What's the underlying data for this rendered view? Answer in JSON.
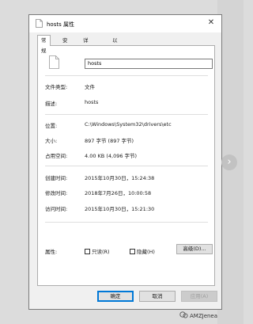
{
  "window": {
    "title": "hosts 属性",
    "close_glyph": "✕"
  },
  "tabs": [
    {
      "label": "常规",
      "active": true
    },
    {
      "label": "安全"
    },
    {
      "label": "详细信息"
    },
    {
      "label": "以前的版本"
    }
  ],
  "general": {
    "filename": "hosts",
    "fields": [
      {
        "label": "文件类型:",
        "value": "文件"
      },
      {
        "label": "描述:",
        "value": "hosts"
      },
      {
        "label": "位置:",
        "value": "C:\\Windows\\System32\\drivers\\etc"
      },
      {
        "label": "大小:",
        "value": "897 字节 (897 字节)"
      },
      {
        "label": "占用空间:",
        "value": "4.00 KB (4,096 字节)"
      },
      {
        "label": "创建时间:",
        "value": "2015年10月30日，15:24:38"
      },
      {
        "label": "修改时间:",
        "value": "2018年7月26日，10:00:58"
      },
      {
        "label": "访问时间:",
        "value": "2015年10月30日，15:21:30"
      }
    ],
    "attributes_label": "属性:",
    "readonly_label": "只读(R)",
    "readonly_checked": false,
    "hidden_label": "隐藏(H)",
    "hidden_checked": false,
    "advanced_label": "高级(D)..."
  },
  "footer": {
    "ok": "确定",
    "cancel": "取消",
    "apply": "应用(A)"
  },
  "overlay": {
    "next_glyph": "›",
    "watermark": "AMZJenea"
  },
  "colors": {
    "accent": "#0078d7",
    "panel": "#ffffff",
    "dialog": "#f0f0f0"
  }
}
